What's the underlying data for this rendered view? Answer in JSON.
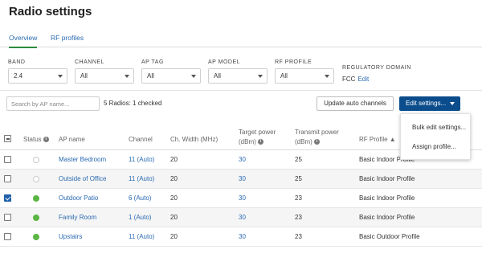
{
  "page": {
    "title": "Radio settings"
  },
  "tabs": [
    {
      "label": "Overview",
      "active": true
    },
    {
      "label": "RF profiles",
      "active": false
    }
  ],
  "filters": {
    "band": {
      "label": "BAND",
      "value": "2.4"
    },
    "channel": {
      "label": "CHANNEL",
      "value": "All"
    },
    "ap_tag": {
      "label": "AP TAG",
      "value": "All"
    },
    "ap_model": {
      "label": "AP MODEL",
      "value": "All"
    },
    "rf_profile": {
      "label": "RF PROFILE",
      "value": "All"
    },
    "regulatory": {
      "label": "REGULATORY DOMAIN",
      "value": "FCC",
      "edit_label": "Edit"
    }
  },
  "toolbar": {
    "search_placeholder": "Search by AP name...",
    "count_text": "5 Radios: 1 checked",
    "update_label": "Update auto channels",
    "edit_label": "Edit settings..."
  },
  "edit_menu": {
    "items": [
      "Bulk edit settings...",
      "Assign profile..."
    ]
  },
  "table": {
    "columns": {
      "status": "Status",
      "ap_name": "AP name",
      "channel": "Channel",
      "width": "Ch. Width (MHz)",
      "target_power_1": "Target power",
      "target_power_2": "(dBm)",
      "transmit_power_1": "Transmit power",
      "transmit_power_2": "(dBm)",
      "rf_profile": "RF Profile",
      "sort_indicator": "▲"
    },
    "rows": [
      {
        "checked": false,
        "status": "offline",
        "ap_name": "Master Bedroom",
        "channel": "11 (Auto)",
        "width": "20",
        "target_power": "30",
        "transmit_power": "25",
        "rf_profile": "Basic Indoor Profile"
      },
      {
        "checked": false,
        "status": "offline",
        "ap_name": "Outside of Office",
        "channel": "11 (Auto)",
        "width": "20",
        "target_power": "30",
        "transmit_power": "25",
        "rf_profile": "Basic Indoor Profile"
      },
      {
        "checked": true,
        "status": "online",
        "ap_name": "Outdoor Patio",
        "channel": "6 (Auto)",
        "width": "20",
        "target_power": "30",
        "transmit_power": "23",
        "rf_profile": "Basic Indoor Profile"
      },
      {
        "checked": false,
        "status": "online",
        "ap_name": "Family Room",
        "channel": "1 (Auto)",
        "width": "20",
        "target_power": "30",
        "transmit_power": "23",
        "rf_profile": "Basic Indoor Profile"
      },
      {
        "checked": false,
        "status": "online",
        "ap_name": "Upstairs",
        "channel": "11 (Auto)",
        "width": "20",
        "target_power": "30",
        "transmit_power": "23",
        "rf_profile": "Basic Outdoor Profile"
      }
    ]
  },
  "colors": {
    "accent": "#2a6ab0",
    "primary_button": "#0b4c8c",
    "status_online": "#5bb544",
    "active_tab": "#2b8a3e"
  }
}
